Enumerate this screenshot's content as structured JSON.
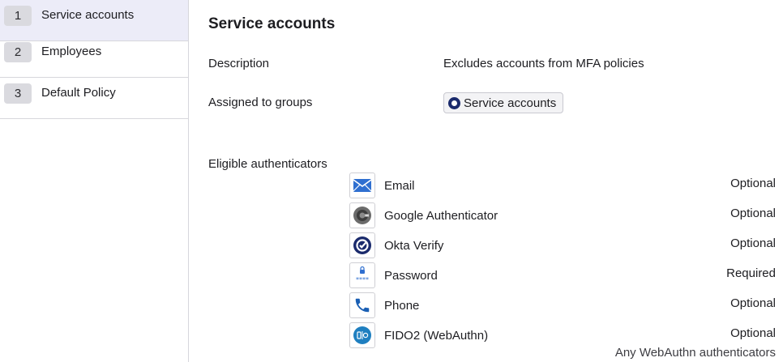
{
  "sidebar": {
    "items": [
      {
        "number": "1",
        "label": "Service accounts"
      },
      {
        "number": "2",
        "label": "Employees"
      },
      {
        "number": "3",
        "label": "Default Policy"
      }
    ]
  },
  "policy": {
    "title": "Service accounts",
    "description_label": "Description",
    "description_value": "Excludes accounts from MFA policies",
    "groups_label": "Assigned to groups",
    "group_chip": "Service accounts",
    "authenticators_label": "Eligible authenticators",
    "authenticators": [
      {
        "name": "Email",
        "status": "Optional",
        "icon": "email-icon"
      },
      {
        "name": "Google Authenticator",
        "status": "Optional",
        "icon": "google-authenticator-icon"
      },
      {
        "name": "Okta Verify",
        "status": "Optional",
        "icon": "okta-verify-icon"
      },
      {
        "name": "Password",
        "status": "Required",
        "icon": "password-icon"
      },
      {
        "name": "Phone",
        "status": "Optional",
        "icon": "phone-icon"
      },
      {
        "name": "FIDO2 (WebAuthn)",
        "status": "Optional",
        "icon": "fido2-icon"
      }
    ],
    "fido_note": "Any WebAuthn authenticators"
  },
  "colors": {
    "active_bg": "#ececf8",
    "okta_navy": "#1a2a6c",
    "email_blue": "#2f6fd0",
    "phone_blue": "#1a5fb4",
    "fido_blue": "#1f7fc0"
  }
}
